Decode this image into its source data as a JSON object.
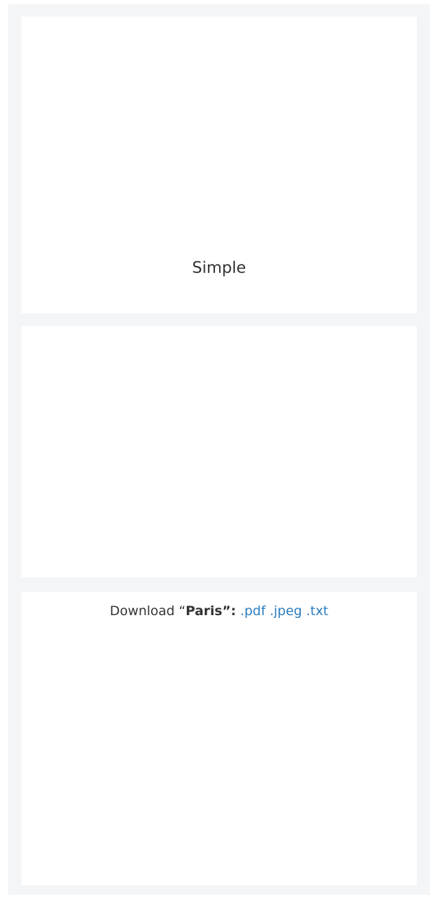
{
  "panels": [
    {
      "id": "panel-1",
      "text": "Simple"
    },
    {
      "id": "panel-2",
      "text": ""
    },
    {
      "id": "panel-3",
      "download": {
        "prefix": "Download “",
        "name": "Paris”:",
        "links": [
          ".pdf",
          ".jpeg",
          ".txt"
        ]
      }
    }
  ],
  "colors": {
    "background": "#f4f5f7",
    "panel": "#ffffff",
    "text": "#333333",
    "link": "#2a7dc0"
  }
}
